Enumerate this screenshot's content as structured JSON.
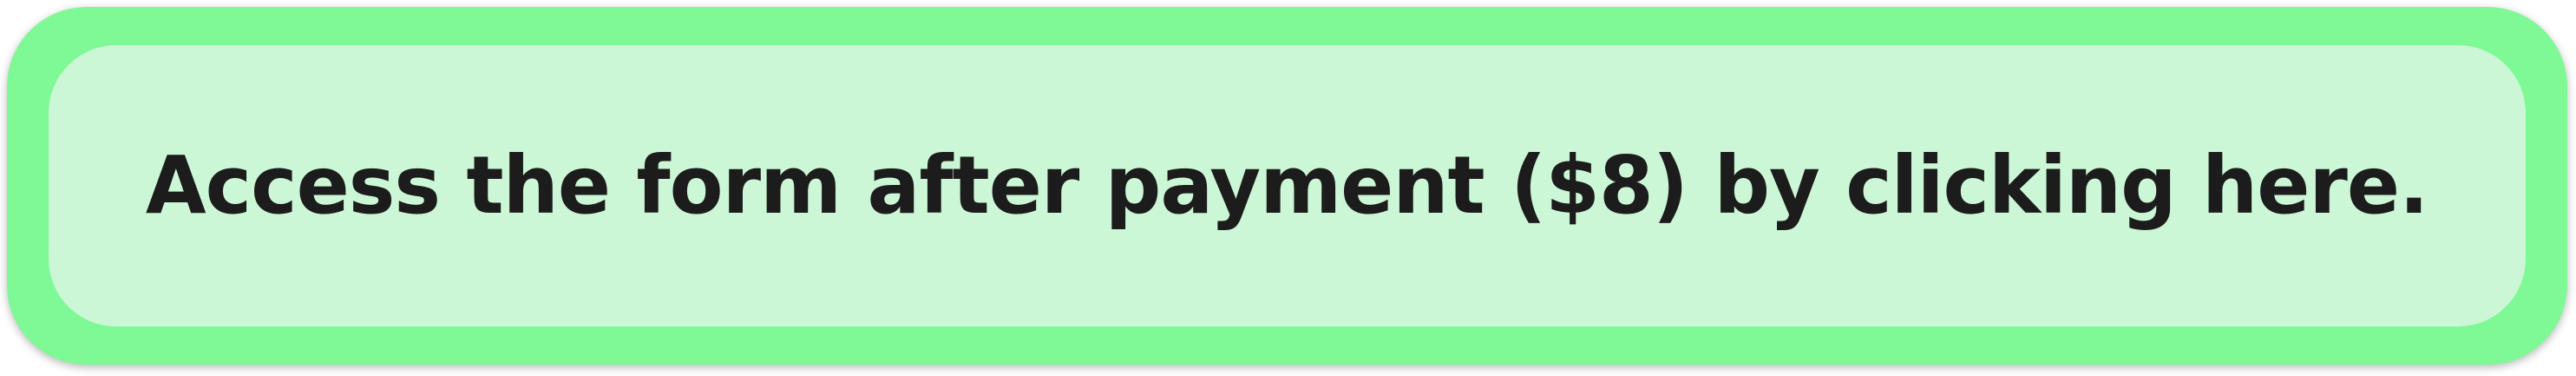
{
  "cta": {
    "label": "Access the form after payment ($8) by clicking here.",
    "outer_color": "#7ef995",
    "inner_color": "#ccf7d6",
    "text_color": "#1c1c1c"
  }
}
